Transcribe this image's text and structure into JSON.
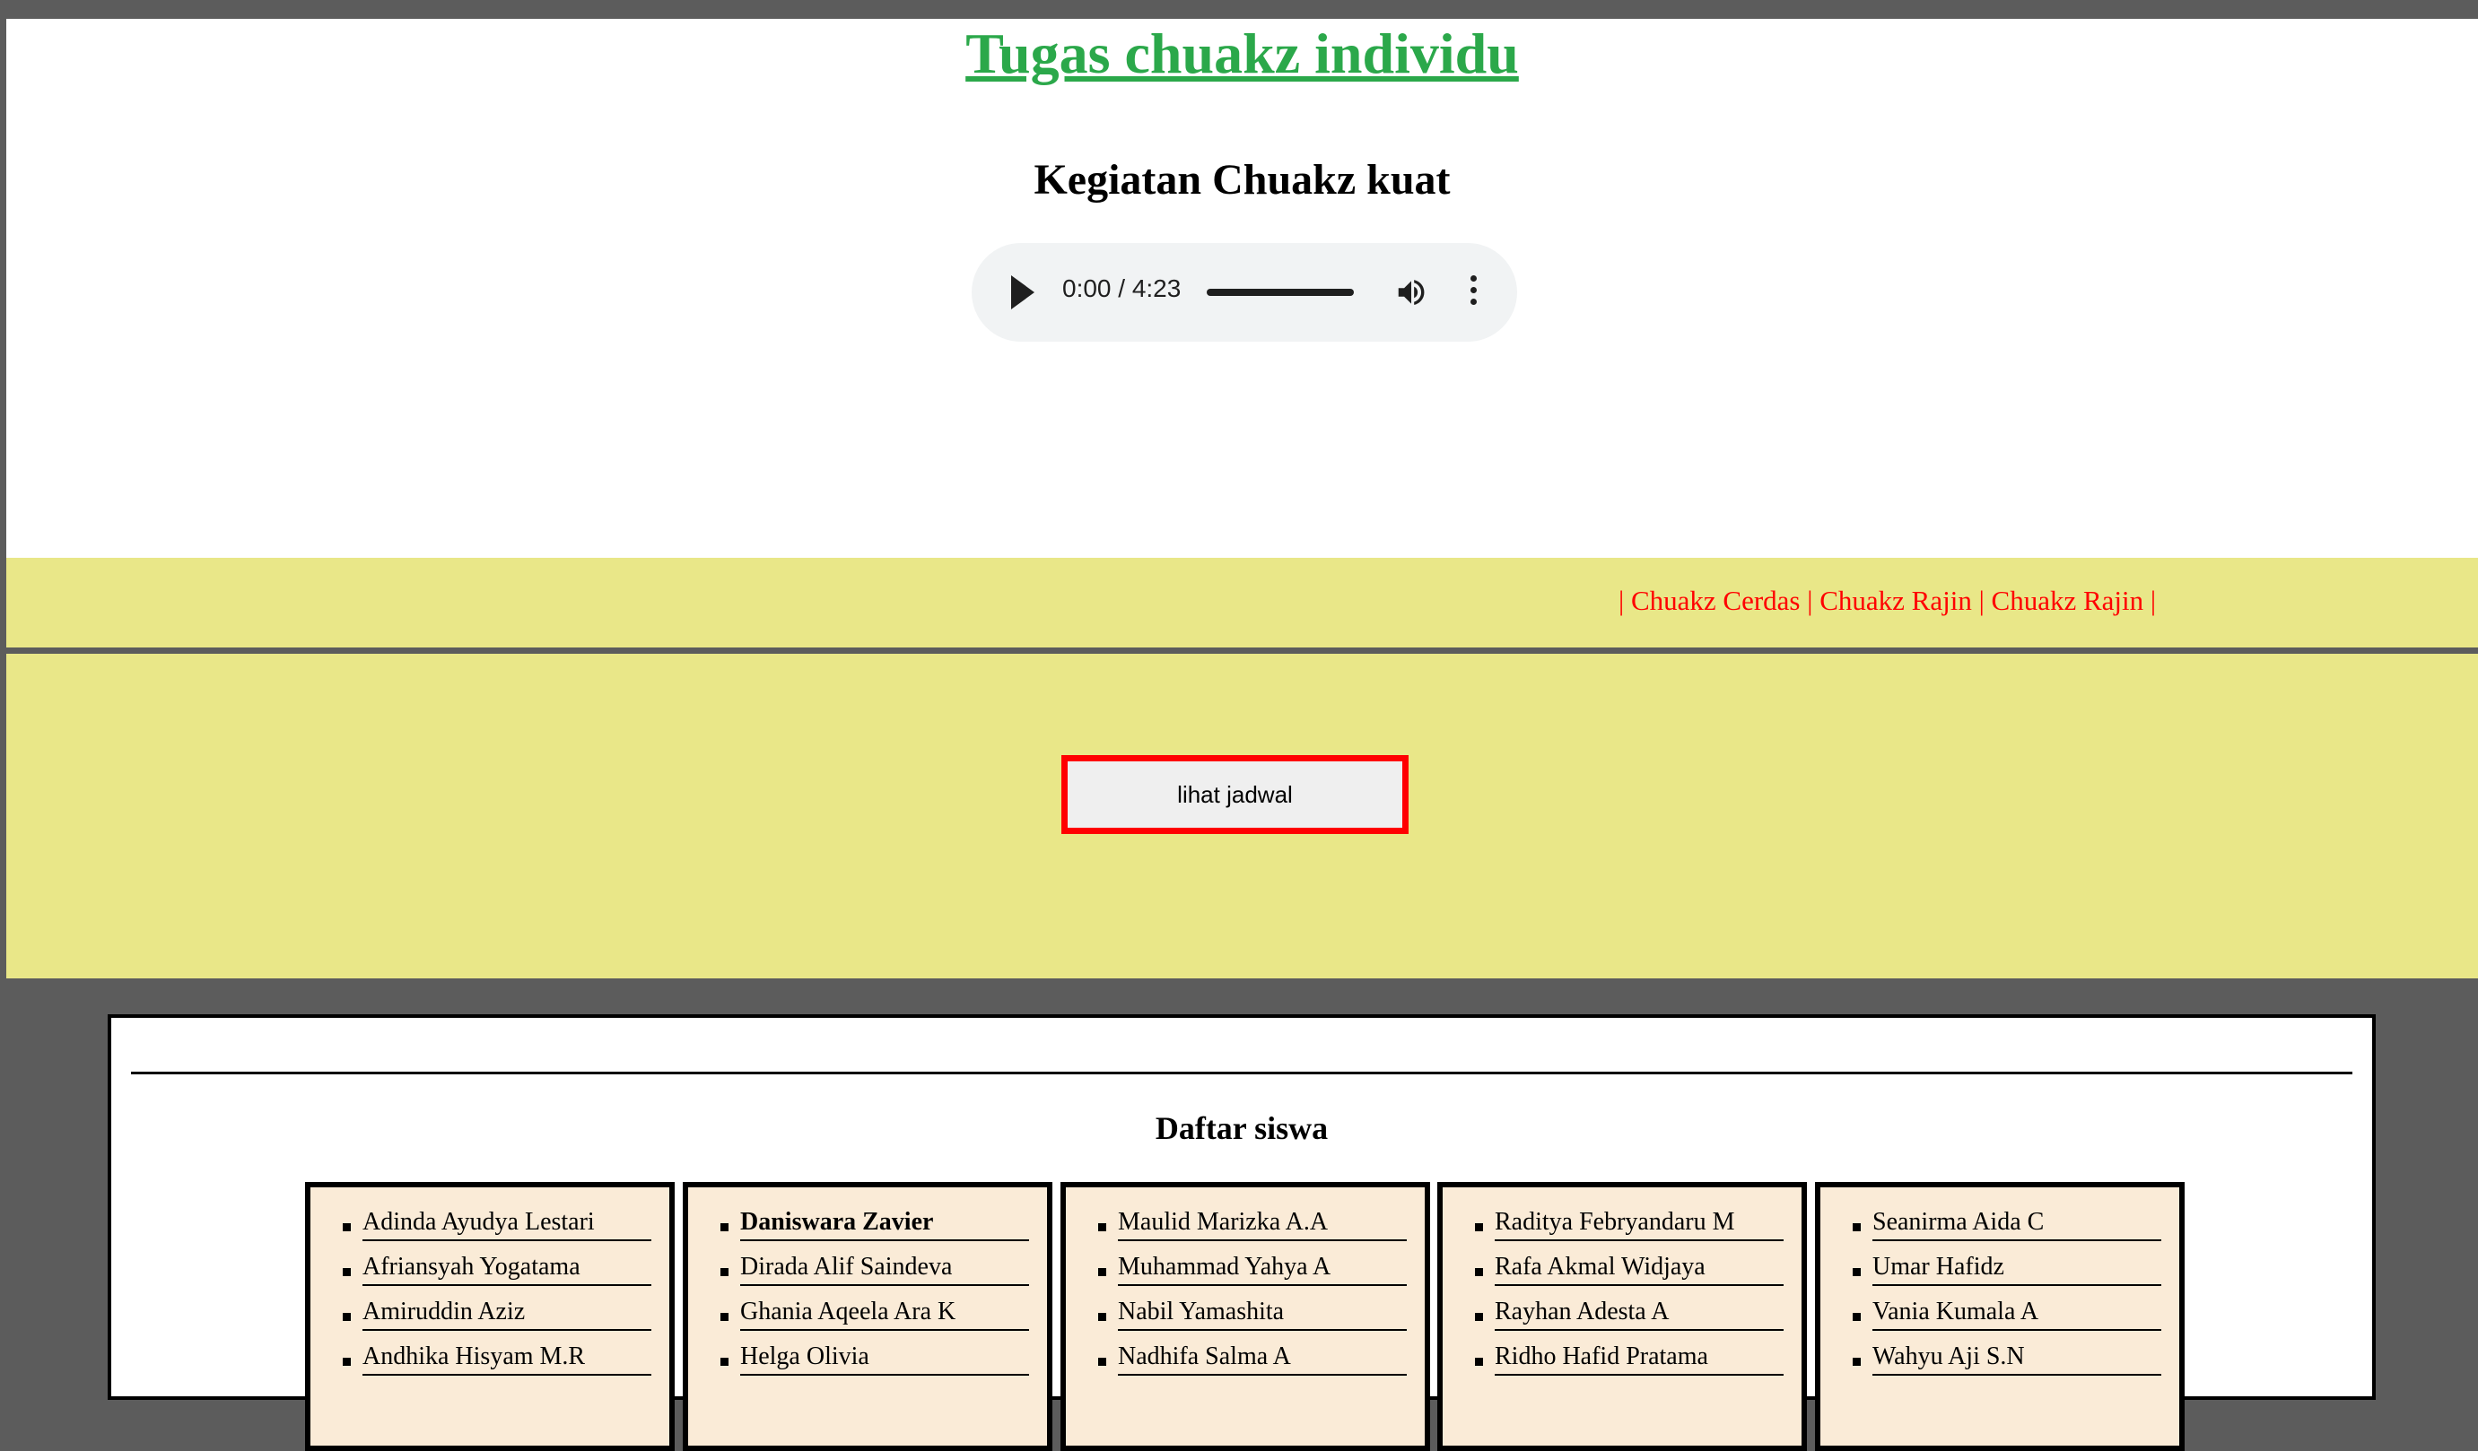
{
  "header": {
    "title": "Tugas chuakz individu",
    "subtitle": "Kegiatan Chuakz kuat",
    "audio": {
      "time": "0:00 / 4:23"
    }
  },
  "nav": {
    "sep": "|",
    "links": [
      "Chuakz Cerdas",
      "Chuakz Rajin",
      "Chuakz Rajin"
    ]
  },
  "button": {
    "label": "lihat jadwal"
  },
  "students": {
    "heading": "Daftar siswa",
    "columns": [
      [
        "Adinda Ayudya Lestari",
        "Afriansyah Yogatama",
        "Amiruddin Aziz",
        "Andhika Hisyam M.R"
      ],
      [
        "Daniswara Zavier",
        "Dirada Alif Saindeva",
        "Ghania Aqeela Ara K",
        "Helga Olivia"
      ],
      [
        "Maulid Marizka A.A",
        "Muhammad Yahya A",
        "Nabil Yamashita",
        "Nadhifa Salma A"
      ],
      [
        "Raditya Febryandaru M",
        "Rafa Akmal Widjaya",
        "Rayhan Adesta A",
        "Ridho Hafid Pratama"
      ],
      [
        "Seanirma Aida C",
        "Umar Hafidz",
        "Vania Kumala A",
        "Wahyu Aji S.N"
      ]
    ]
  }
}
